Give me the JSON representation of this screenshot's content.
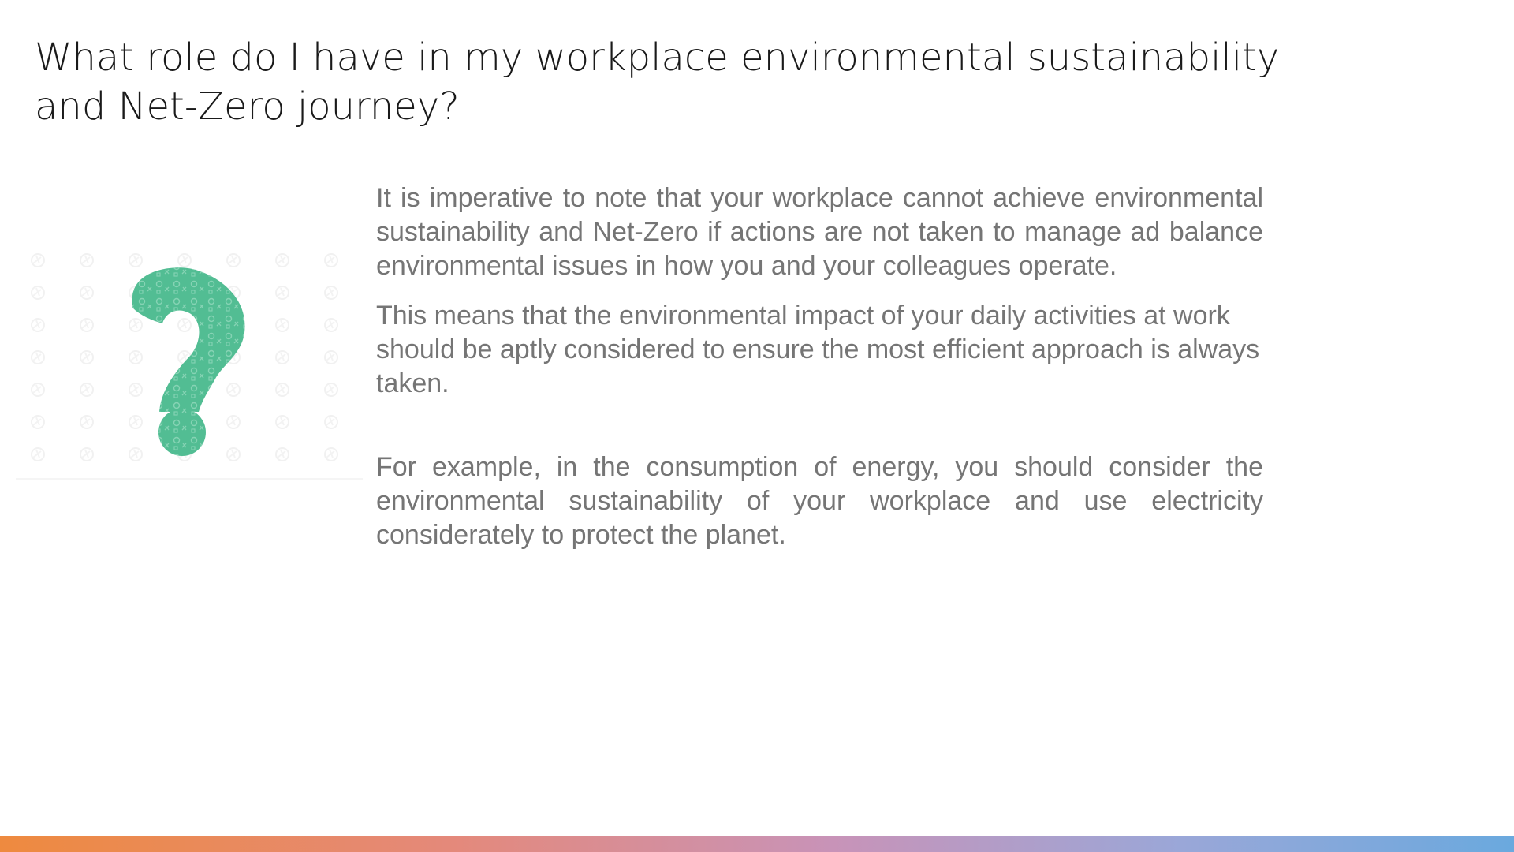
{
  "slide": {
    "title": "What role do I have in my workplace environmental sustainability and Net-Zero journey?",
    "paragraphs": [
      "It is imperative to note that your workplace cannot achieve environmental sustainability and Net-Zero if actions are not taken to manage ad balance environmental issues in how you and your colleagues operate.",
      "This means that the environmental impact of your daily activities at work should be aptly considered to ensure the most efficient approach is always taken.",
      "For example, in the consumption of energy, you should consider the environmental sustainability of your workplace and use electricity considerately to protect the planet."
    ],
    "illustration_icon": "question-mark-icon"
  },
  "colors": {
    "title_text": "#1a1a1a",
    "body_text": "#757575",
    "question_mark": "#52bd93",
    "bottom_bar_start": "#ee8a3f",
    "bottom_bar_end": "#6aa9de"
  }
}
